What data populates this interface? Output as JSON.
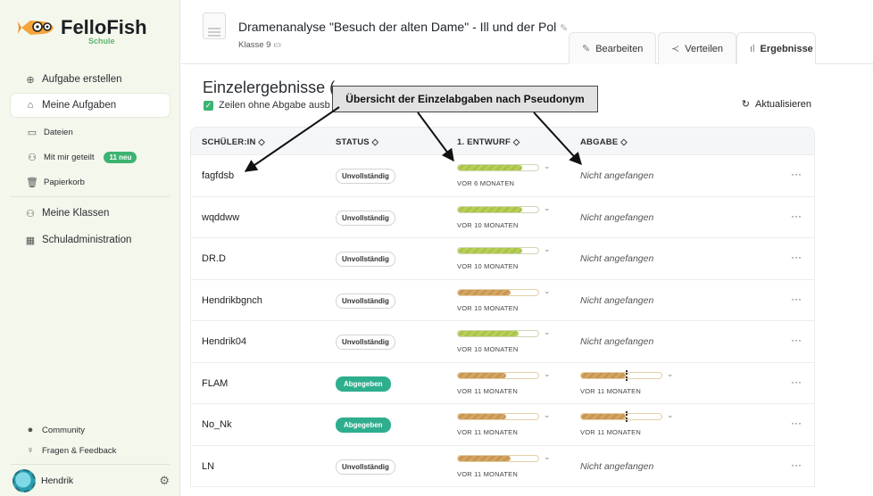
{
  "sidebar": {
    "brand": "FelloFish",
    "brand_sub": "Schule",
    "items": [
      {
        "label": "Aufgabe erstellen",
        "icon": "plus-circle-icon"
      },
      {
        "label": "Meine Aufgaben",
        "icon": "home-icon"
      },
      {
        "label": "Dateien",
        "icon": "folder-icon"
      },
      {
        "label": "Mit mir geteilt",
        "icon": "share-icon",
        "badge": "11 neu"
      },
      {
        "label": "Papierkorb",
        "icon": "trash-icon"
      },
      {
        "label": "Meine Klassen",
        "icon": "users-icon"
      },
      {
        "label": "Schuladministration",
        "icon": "building-icon"
      }
    ],
    "footer": [
      {
        "label": "Community",
        "icon": "discord-icon"
      },
      {
        "label": "Fragen & Feedback",
        "icon": "bulb-icon"
      }
    ],
    "user": "Hendrik"
  },
  "header": {
    "title": "Dramenanalyse \"Besuch der alten Dame\" - Ill und der Pol",
    "subtitle": "Klasse 9",
    "tabs": [
      {
        "label": "Bearbeiten",
        "icon": "edit-icon"
      },
      {
        "label": "Verteilen",
        "icon": "share-icon"
      },
      {
        "label": "Ergebnisse",
        "icon": "chart-icon",
        "active": true
      }
    ]
  },
  "main": {
    "heading": "Einzelergebnisse (",
    "checkbox_label": "Zeilen ohne Abgabe ausb",
    "refresh_label": "Aktualisieren",
    "columns": [
      "SCHÜLER:IN ◇",
      "STATUS ◇",
      "1. ENTWURF ◇",
      "ABGABE ◇"
    ],
    "rows": [
      {
        "name": "fagfdsb",
        "status": "Unvollständig",
        "done": false,
        "draft_fill": 0.8,
        "draft_color": "green",
        "draft_ago": "VOR 6 MONATEN",
        "submission": "Nicht angefangen"
      },
      {
        "name": "wqddww",
        "status": "Unvollständig",
        "done": false,
        "draft_fill": 0.8,
        "draft_color": "green",
        "draft_ago": "VOR 10 MONATEN",
        "submission": "Nicht angefangen"
      },
      {
        "name": "DR.D",
        "status": "Unvollständig",
        "done": false,
        "draft_fill": 0.8,
        "draft_color": "green",
        "draft_ago": "VOR 10 MONATEN",
        "submission": "Nicht angefangen"
      },
      {
        "name": "Hendrikbgnch",
        "status": "Unvollständig",
        "done": false,
        "draft_fill": 0.65,
        "draft_color": "orange",
        "draft_ago": "VOR 10 MONATEN",
        "submission": "Nicht angefangen"
      },
      {
        "name": "Hendrik04",
        "status": "Unvollständig",
        "done": false,
        "draft_fill": 0.75,
        "draft_color": "green",
        "draft_ago": "VOR 10 MONATEN",
        "submission": "Nicht angefangen"
      },
      {
        "name": "FLAM",
        "status": "Abgegeben",
        "done": true,
        "draft_fill": 0.6,
        "draft_color": "orange",
        "draft_ago": "VOR 11 MONATEN",
        "sub_fill": 0.55,
        "sub_ago": "VOR 11 MONATEN"
      },
      {
        "name": "No_Nk",
        "status": "Abgegeben",
        "done": true,
        "draft_fill": 0.6,
        "draft_color": "orange",
        "draft_ago": "VOR 11 MONATEN",
        "sub_fill": 0.55,
        "sub_ago": "VOR 11 MONATEN"
      },
      {
        "name": "LN",
        "status": "Unvollständig",
        "done": false,
        "draft_fill": 0.65,
        "draft_color": "orange",
        "draft_ago": "VOR 11 MONATEN",
        "submission": "Nicht angefangen"
      }
    ],
    "row_menu": "···"
  },
  "annotation": {
    "text": "Übersicht der Einzelabgaben nach Pseudonym"
  },
  "colors": {
    "accent": "#3cb371",
    "done": "#2fae8e",
    "sidebar_bg": "#f4f7ec"
  }
}
